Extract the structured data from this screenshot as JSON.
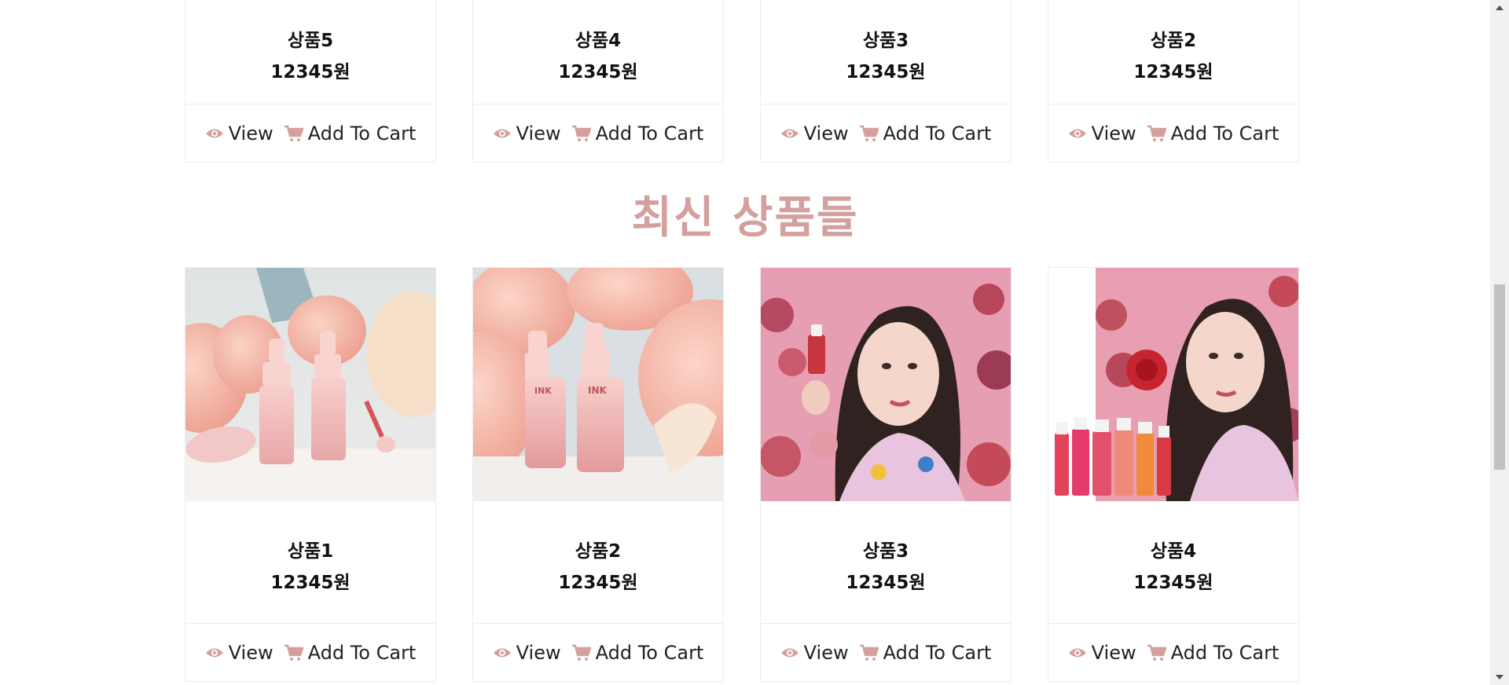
{
  "accent_color": "#d4a09d",
  "section_title": "최신 상품들",
  "actions": {
    "view_label": "View",
    "cart_label": "Add To Cart"
  },
  "top_products": [
    {
      "name": "상품5",
      "price": "12345원"
    },
    {
      "name": "상품4",
      "price": "12345원"
    },
    {
      "name": "상품3",
      "price": "12345원"
    },
    {
      "name": "상품2",
      "price": "12345원"
    }
  ],
  "new_products": [
    {
      "name": "상품1",
      "price": "12345원",
      "image": "peach-tint-bottles-photo"
    },
    {
      "name": "상품2",
      "price": "12345원",
      "image": "peach-tint-closeup-photo"
    },
    {
      "name": "상품3",
      "price": "12345원",
      "image": "model-with-tint-photo"
    },
    {
      "name": "상품4",
      "price": "12345원",
      "image": "model-with-rose-and-tints-photo"
    }
  ],
  "icons": {
    "view": "eye-icon",
    "cart": "cart-icon"
  }
}
